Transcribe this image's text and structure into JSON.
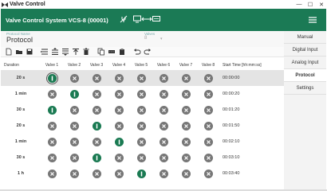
{
  "window": {
    "title": "Valve Control",
    "controls": [
      "—",
      "☐",
      "✕"
    ]
  },
  "appbar": {
    "title": "Valve Control System VCS-8 (00001)",
    "accent": "#1b7a55"
  },
  "protocol_name": {
    "label": "Protocol Name",
    "value": "Protocol"
  },
  "valves_field": {
    "label": "Valves",
    "value": "8"
  },
  "toolbar": {
    "icons": [
      "new-file-icon",
      "open-folder-icon",
      "save-icon",
      "insert-row-icon",
      "insert-above-icon",
      "insert-below-icon",
      "move-up-icon",
      "delete-icon",
      "copy-icon",
      "cut-icon",
      "paste-icon",
      "undo-icon",
      "redo-icon"
    ]
  },
  "table": {
    "headers": {
      "duration": "Duration",
      "valves": [
        "Valve 1",
        "Valve 2",
        "Valve 3",
        "Valve 4",
        "Valve 5",
        "Valve 6",
        "Valve 7",
        "Valve 8"
      ],
      "start": "Start Time [hh:mm:ss]"
    },
    "rows": [
      {
        "duration": "20 s",
        "start": "00:00:00",
        "open_valve": 1,
        "selected": true
      },
      {
        "duration": "1 min",
        "start": "00:00:20",
        "open_valve": 2,
        "selected": false
      },
      {
        "duration": "30 s",
        "start": "00:01:20",
        "open_valve": 1,
        "selected": false
      },
      {
        "duration": "20 s",
        "start": "00:01:50",
        "open_valve": 3,
        "selected": false
      },
      {
        "duration": "1 min",
        "start": "00:02:10",
        "open_valve": 4,
        "selected": false
      },
      {
        "duration": "30 s",
        "start": "00:03:10",
        "open_valve": 3,
        "selected": false
      },
      {
        "duration": "1 h",
        "start": "00:03:40",
        "open_valve": 5,
        "selected": false
      }
    ]
  },
  "sidebar": {
    "items": [
      {
        "label": "Manual",
        "active": false
      },
      {
        "label": "Digital Input",
        "active": false
      },
      {
        "label": "Analog Input",
        "active": false
      },
      {
        "label": "Protocol",
        "active": true
      },
      {
        "label": "Settings",
        "active": false
      }
    ]
  }
}
